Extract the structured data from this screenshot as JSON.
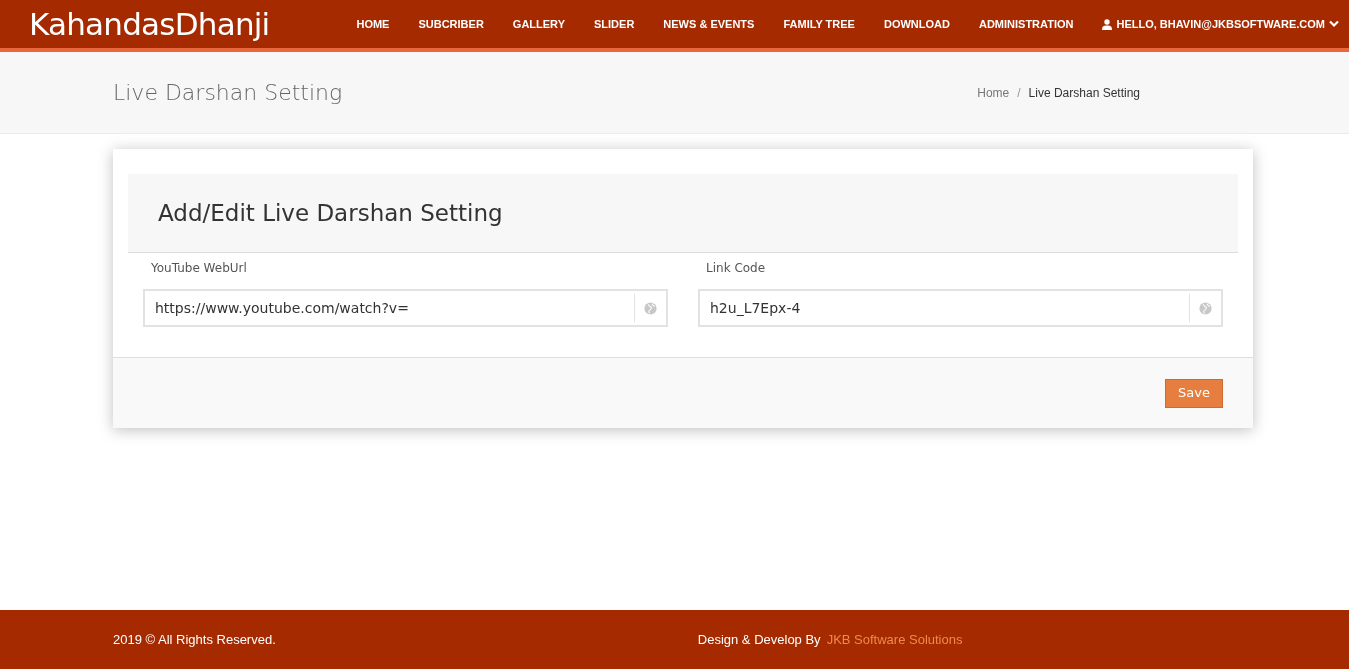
{
  "brand": "KahandasDhanji",
  "nav": [
    {
      "label": "HOME"
    },
    {
      "label": "SUBCRIBER"
    },
    {
      "label": "GALLERY"
    },
    {
      "label": "SLIDER"
    },
    {
      "label": "NEWS & EVENTS"
    },
    {
      "label": "FAMILY TREE"
    },
    {
      "label": "DOWNLOAD"
    },
    {
      "label": "ADMINISTRATION"
    }
  ],
  "user_menu": "HELLO, BHAVIN@JKBSOFTWARE.COM",
  "page_title": "Live Darshan Setting",
  "breadcrumb": [
    "Home",
    "Live Darshan Setting"
  ],
  "breadcrumb_separator": "/",
  "form": {
    "title": "Add/Edit Live Darshan Setting",
    "fields": [
      {
        "label": "YouTube WebUrl",
        "value": "https://www.youtube.com/watch?v="
      },
      {
        "label": "Link Code",
        "value": "h2u_L7Epx-4"
      }
    ],
    "button": "Save"
  },
  "footer": {
    "copyright": "2019 © All Rights Reserved.",
    "credit": "Design & Develop By",
    "credit_link": "JKB Software Solutions"
  }
}
